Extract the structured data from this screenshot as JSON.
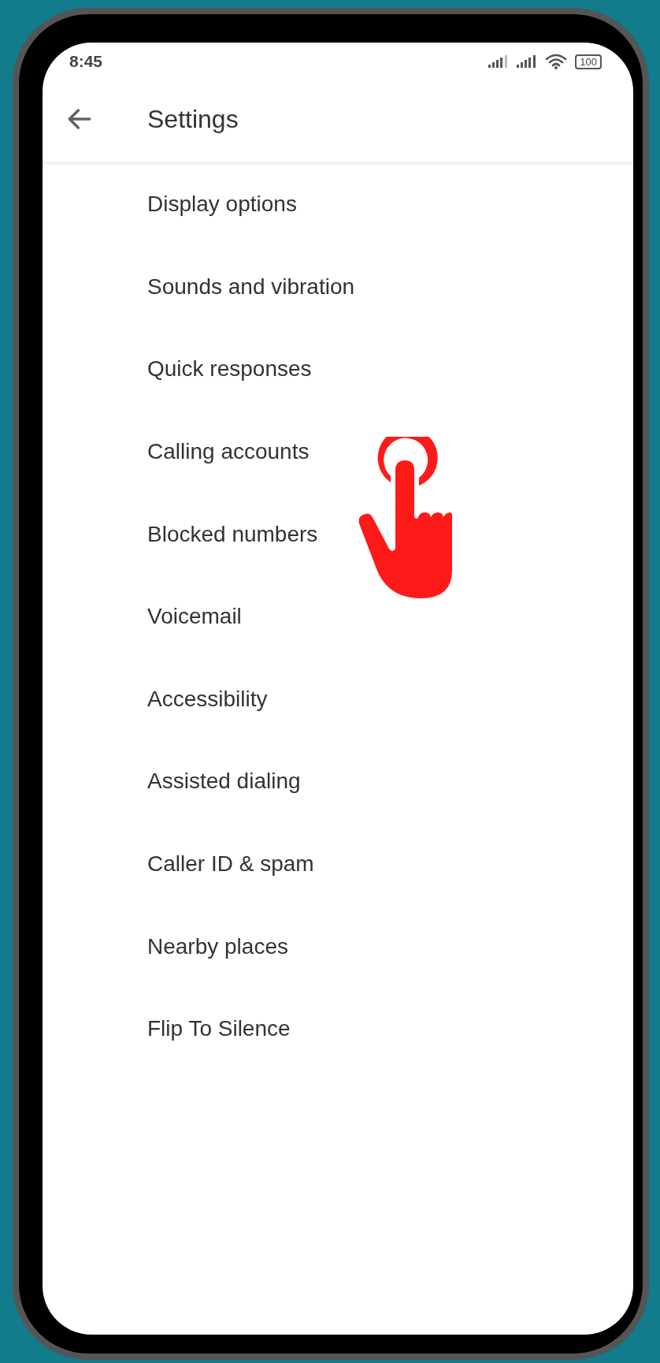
{
  "status_bar": {
    "time": "8:45",
    "battery": "100"
  },
  "app_bar": {
    "title": "Settings"
  },
  "items": [
    {
      "label": "Display options"
    },
    {
      "label": "Sounds and vibration"
    },
    {
      "label": "Quick responses"
    },
    {
      "label": "Calling accounts"
    },
    {
      "label": "Blocked numbers"
    },
    {
      "label": "Voicemail"
    },
    {
      "label": "Accessibility"
    },
    {
      "label": "Assisted dialing"
    },
    {
      "label": "Caller ID & spam"
    },
    {
      "label": "Nearby places"
    },
    {
      "label": "Flip To Silence"
    }
  ]
}
